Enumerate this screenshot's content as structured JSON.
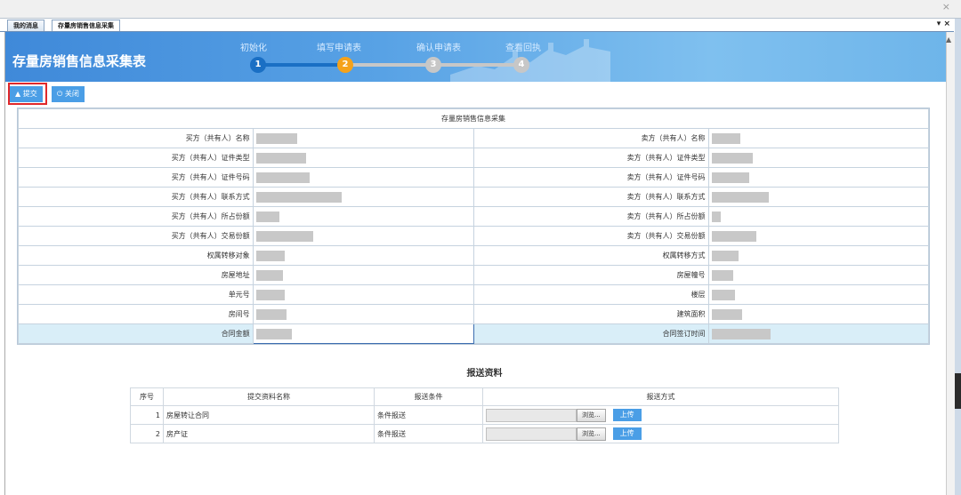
{
  "tabs": [
    {
      "label": "我的消息"
    },
    {
      "label": "存量房销售信息采集"
    }
  ],
  "tab_controls": "▾ ×",
  "window_close": "×",
  "banner": {
    "title": "存量房销售信息采集表",
    "steps": [
      {
        "num": "1",
        "label": "初始化",
        "state": "done"
      },
      {
        "num": "2",
        "label": "填写申请表",
        "state": "current"
      },
      {
        "num": "3",
        "label": "确认申请表",
        "state": "todo"
      },
      {
        "num": "4",
        "label": "查看回执",
        "state": "todo"
      }
    ]
  },
  "toolbar": {
    "submit_label": "提交",
    "close_label": "关闭"
  },
  "form": {
    "title": "存量房销售信息采集",
    "rows": [
      {
        "left": "买方（共有人）名称",
        "right": "卖方（共有人）名称"
      },
      {
        "left": "买方（共有人）证件类型",
        "right": "卖方（共有人）证件类型"
      },
      {
        "left": "买方（共有人）证件号码",
        "right": "卖方（共有人）证件号码"
      },
      {
        "left": "买方（共有人）联系方式",
        "right": "卖方（共有人）联系方式"
      },
      {
        "left": "买方（共有人）所占份额",
        "right": "卖方（共有人）所占份额"
      },
      {
        "left": "买方（共有人）交易份额",
        "right": "卖方（共有人）交易份额"
      },
      {
        "left": "权属转移对象",
        "right": "权属转移方式"
      },
      {
        "left": "房屋地址",
        "right": "房屋幢号"
      },
      {
        "left": "单元号",
        "right": "楼层"
      },
      {
        "left": "房间号",
        "right": "建筑面积"
      },
      {
        "left": "合同金额",
        "right": "合同签订时间"
      }
    ]
  },
  "materials": {
    "title": "报送资料",
    "headers": [
      "序号",
      "提交资料名称",
      "报送条件",
      "报送方式"
    ],
    "rows": [
      {
        "no": "1",
        "name": "房屋转让合同",
        "cond": "条件报送",
        "browse": "浏览...",
        "upload": "上传"
      },
      {
        "no": "2",
        "name": "房产证",
        "cond": "条件报送",
        "browse": "浏览...",
        "upload": "上传"
      }
    ]
  },
  "colors": {
    "accent": "#4a9ee6",
    "step_done": "#1a6fc4",
    "step_current": "#f5a21b",
    "step_todo": "#c7c7c7",
    "highlight": "#e0282a"
  }
}
